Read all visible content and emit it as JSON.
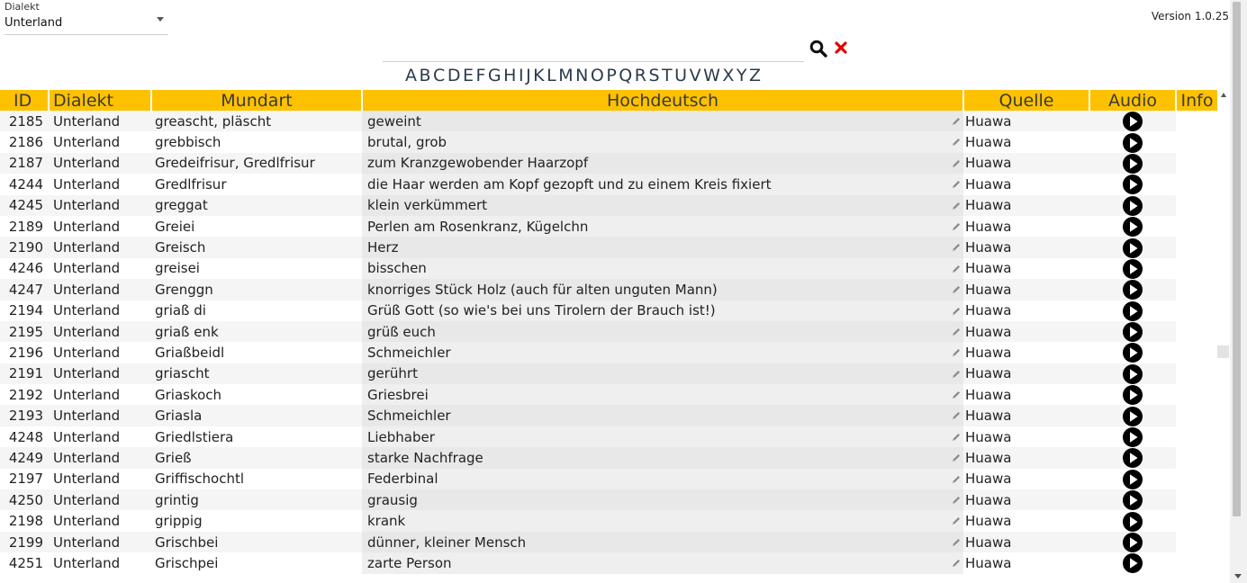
{
  "filter": {
    "dialect_label": "Dialekt",
    "dialect_value": "Unterland"
  },
  "version": "Version 1.0.25",
  "search": {
    "value": ""
  },
  "alphabet": [
    "A",
    "B",
    "C",
    "D",
    "E",
    "F",
    "G",
    "H",
    "I",
    "J",
    "K",
    "L",
    "M",
    "N",
    "O",
    "P",
    "Q",
    "R",
    "S",
    "T",
    "U",
    "V",
    "W",
    "X",
    "Y",
    "Z"
  ],
  "table": {
    "columns": [
      "ID",
      "Dialekt",
      "Mundart",
      "Hochdeutsch",
      "Quelle",
      "Audio",
      "Info"
    ],
    "rows": [
      {
        "id": "2185",
        "dialekt": "Unterland",
        "mundart": "greascht, pläscht",
        "hochdeutsch": "geweint",
        "quelle": "Huawa"
      },
      {
        "id": "2186",
        "dialekt": "Unterland",
        "mundart": "grebbisch",
        "hochdeutsch": "brutal, grob",
        "quelle": "Huawa"
      },
      {
        "id": "2187",
        "dialekt": "Unterland",
        "mundart": "Gredeifrisur, Gredlfrisur",
        "hochdeutsch": "zum Kranzgewobender Haarzopf",
        "quelle": "Huawa"
      },
      {
        "id": "4244",
        "dialekt": "Unterland",
        "mundart": "Gredlfrisur",
        "hochdeutsch": "die Haar werden am Kopf gezopft und zu einem Kreis fixiert",
        "quelle": "Huawa"
      },
      {
        "id": "4245",
        "dialekt": "Unterland",
        "mundart": "greggat",
        "hochdeutsch": "klein verkümmert",
        "quelle": "Huawa"
      },
      {
        "id": "2189",
        "dialekt": "Unterland",
        "mundart": "Greiei",
        "hochdeutsch": "Perlen am Rosenkranz, Kügelchn",
        "quelle": "Huawa"
      },
      {
        "id": "2190",
        "dialekt": "Unterland",
        "mundart": "Greisch",
        "hochdeutsch": "Herz",
        "quelle": "Huawa"
      },
      {
        "id": "4246",
        "dialekt": "Unterland",
        "mundart": "greisei",
        "hochdeutsch": "bisschen",
        "quelle": "Huawa"
      },
      {
        "id": "4247",
        "dialekt": "Unterland",
        "mundart": "Grenggn",
        "hochdeutsch": "knorriges Stück Holz (auch für alten unguten Mann)",
        "quelle": "Huawa"
      },
      {
        "id": "2194",
        "dialekt": "Unterland",
        "mundart": "griaß di",
        "hochdeutsch": "Grüß Gott (so wie's bei uns Tirolern der Brauch ist!)",
        "quelle": "Huawa"
      },
      {
        "id": "2195",
        "dialekt": "Unterland",
        "mundart": "griaß enk",
        "hochdeutsch": "grüß euch",
        "quelle": "Huawa"
      },
      {
        "id": "2196",
        "dialekt": "Unterland",
        "mundart": "Griaßbeidl",
        "hochdeutsch": "Schmeichler",
        "quelle": "Huawa"
      },
      {
        "id": "2191",
        "dialekt": "Unterland",
        "mundart": "griascht",
        "hochdeutsch": "gerührt",
        "quelle": "Huawa"
      },
      {
        "id": "2192",
        "dialekt": "Unterland",
        "mundart": "Griaskoch",
        "hochdeutsch": "Griesbrei",
        "quelle": "Huawa"
      },
      {
        "id": "2193",
        "dialekt": "Unterland",
        "mundart": "Griasla",
        "hochdeutsch": "Schmeichler",
        "quelle": "Huawa"
      },
      {
        "id": "4248",
        "dialekt": "Unterland",
        "mundart": "Griedlstiera",
        "hochdeutsch": "Liebhaber",
        "quelle": "Huawa"
      },
      {
        "id": "4249",
        "dialekt": "Unterland",
        "mundart": "Grieß",
        "hochdeutsch": "starke Nachfrage",
        "quelle": "Huawa"
      },
      {
        "id": "2197",
        "dialekt": "Unterland",
        "mundart": "Griffischochtl",
        "hochdeutsch": "Federbinal",
        "quelle": "Huawa"
      },
      {
        "id": "4250",
        "dialekt": "Unterland",
        "mundart": "grintig",
        "hochdeutsch": "grausig",
        "quelle": "Huawa"
      },
      {
        "id": "2198",
        "dialekt": "Unterland",
        "mundart": "grippig",
        "hochdeutsch": "krank",
        "quelle": "Huawa"
      },
      {
        "id": "2199",
        "dialekt": "Unterland",
        "mundart": "Grischbei",
        "hochdeutsch": "dünner, kleiner Mensch",
        "quelle": "Huawa"
      },
      {
        "id": "4251",
        "dialekt": "Unterland",
        "mundart": "Grischpei",
        "hochdeutsch": "zarte Person",
        "quelle": "Huawa"
      }
    ]
  },
  "icons": {
    "search": "search-icon",
    "clear": "close-icon",
    "edit": "pencil-icon",
    "audio": "play-icon"
  },
  "colors": {
    "header_bg": "#fdc100",
    "clear_icon": "#e00000"
  }
}
